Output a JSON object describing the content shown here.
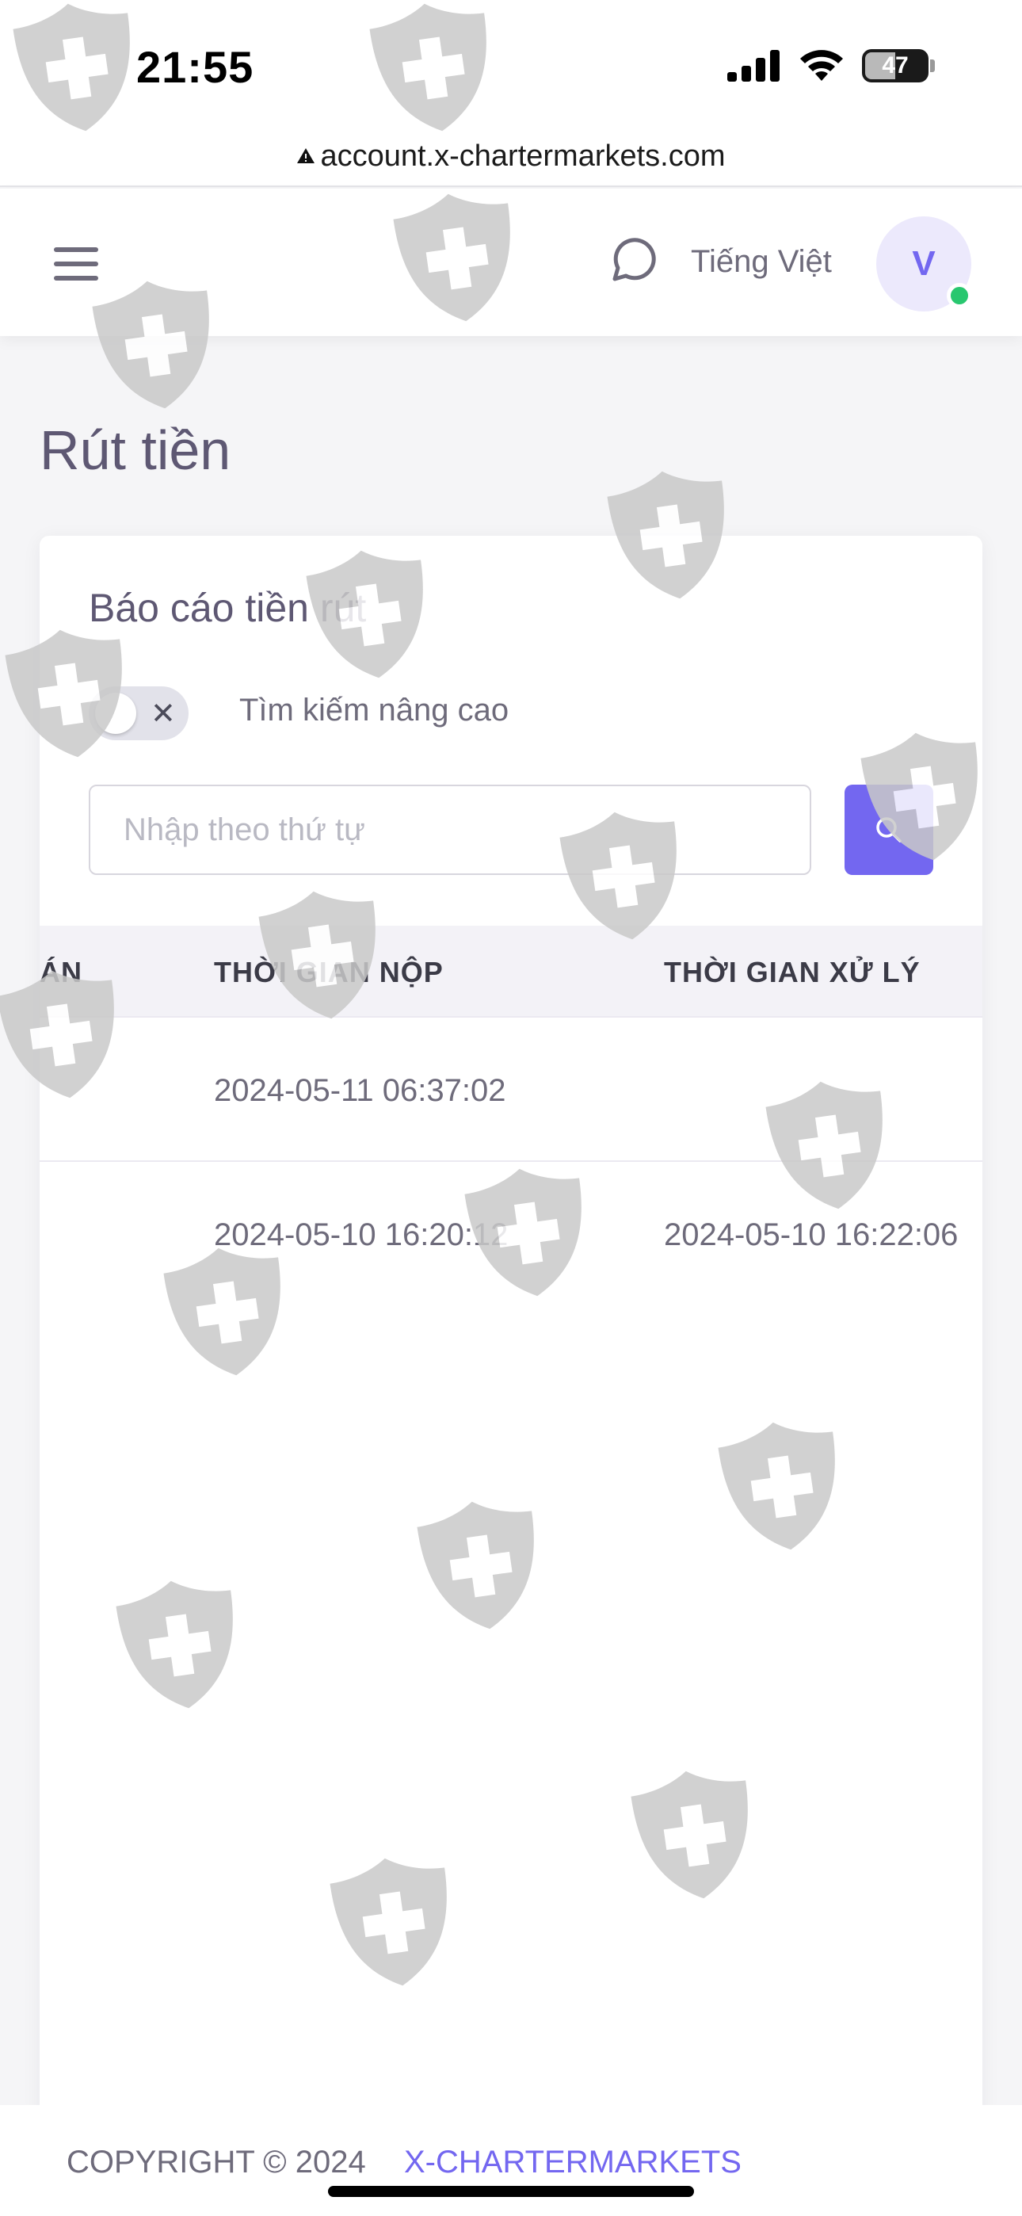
{
  "status_bar": {
    "time": "21:55",
    "battery_level": "47",
    "icons": [
      "signal-icon",
      "wifi-icon",
      "battery-icon"
    ]
  },
  "browser": {
    "url": "account.x-chartermarkets.com",
    "icon": "warning-icon"
  },
  "header": {
    "menu_icon": "hamburger-menu-icon",
    "chat_icon": "chat-bubble-icon",
    "language": "Tiếng Việt",
    "avatar_initial": "V",
    "status_color": "#28c76f"
  },
  "page": {
    "title": "Rút tiền"
  },
  "card": {
    "title": "Báo cáo tiền rút",
    "advanced_search_label": "Tìm kiếm nâng cao",
    "advanced_search_enabled": false,
    "search": {
      "placeholder": "Nhập theo thứ tự",
      "value": ""
    },
    "search_icon": "search-icon"
  },
  "table": {
    "columns": [
      "ÁN",
      "THỜI GIAN NỘP",
      "THỜI GIAN XỬ LÝ"
    ],
    "rows": [
      {
        "col1": "",
        "submitted": "2024-05-11 06:37:02",
        "processed": ""
      },
      {
        "col1": "",
        "submitted": "2024-05-10 16:20:12",
        "processed": "2024-05-10 16:22:06"
      }
    ]
  },
  "footer": {
    "copyright": "COPYRIGHT © 2024",
    "brand": "X-CHARTERMARKETS"
  },
  "colors": {
    "accent": "#7367f0",
    "online": "#28c76f",
    "background": "#f5f5f7",
    "text": "#6e6b7b"
  },
  "watermark_icon": "shield-plus-icon"
}
